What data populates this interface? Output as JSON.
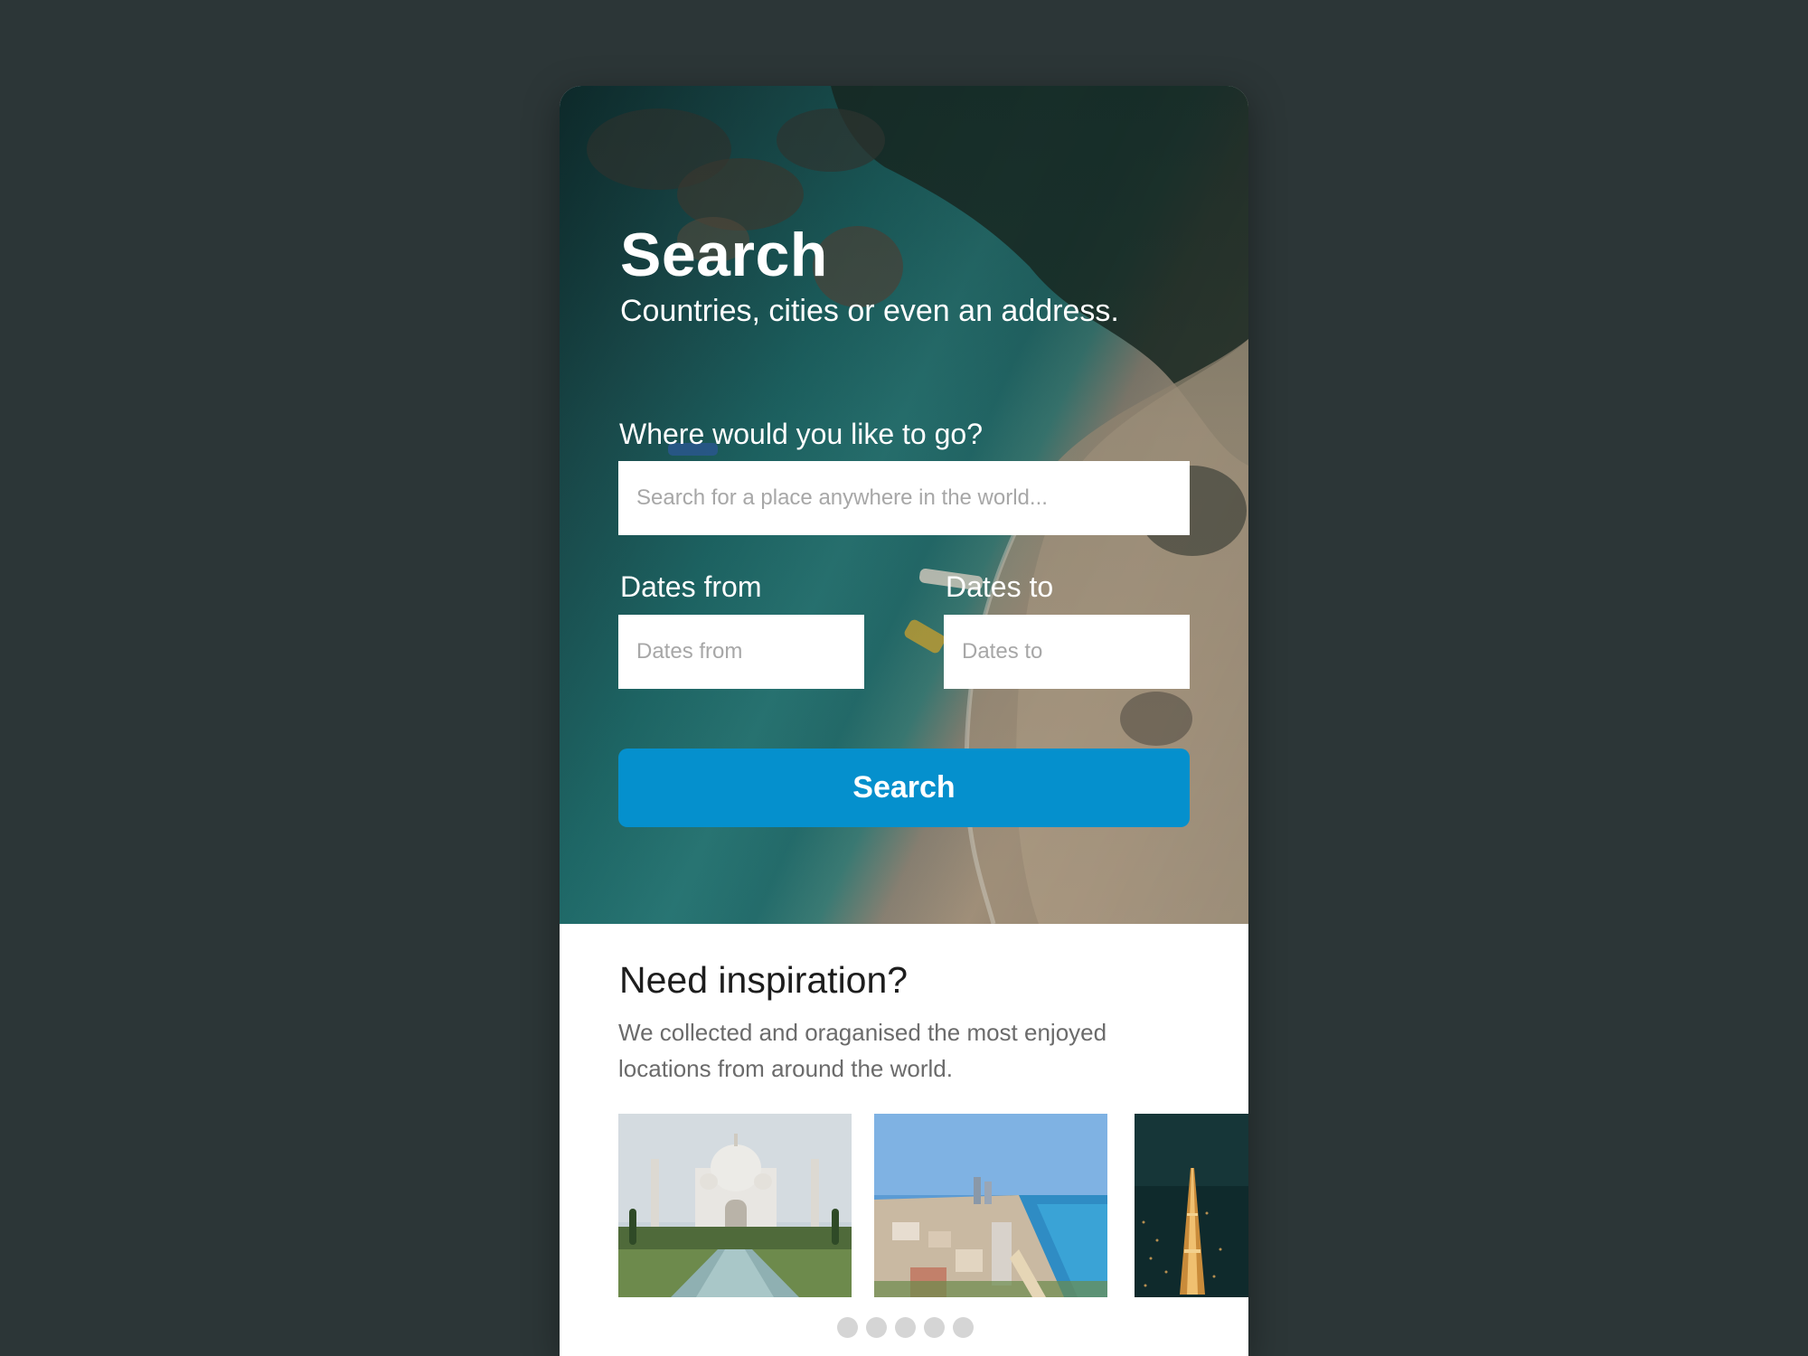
{
  "hero": {
    "title": "Search",
    "subtitle": "Countries, cities or even an address.",
    "where_label": "Where would you like to go?",
    "where_placeholder": "Search for a place anywhere in the world...",
    "from_label": "Dates from",
    "from_placeholder": "Dates from",
    "to_label": "Dates to",
    "to_placeholder": "Dates to",
    "search_button": "Search"
  },
  "inspiration": {
    "title": "Need inspiration?",
    "description": "We collected and oraganised the most enjoyed locations from around the world.",
    "cards": [
      {
        "image": "taj-mahal-photo"
      },
      {
        "image": "coastal-city-photo"
      },
      {
        "image": "eiffel-tower-night-photo"
      }
    ],
    "dots_count": 5
  },
  "colors": {
    "background": "#2c3637",
    "accent": "#0590cd",
    "card": "#ffffff",
    "dot": "#d5d5d5"
  }
}
